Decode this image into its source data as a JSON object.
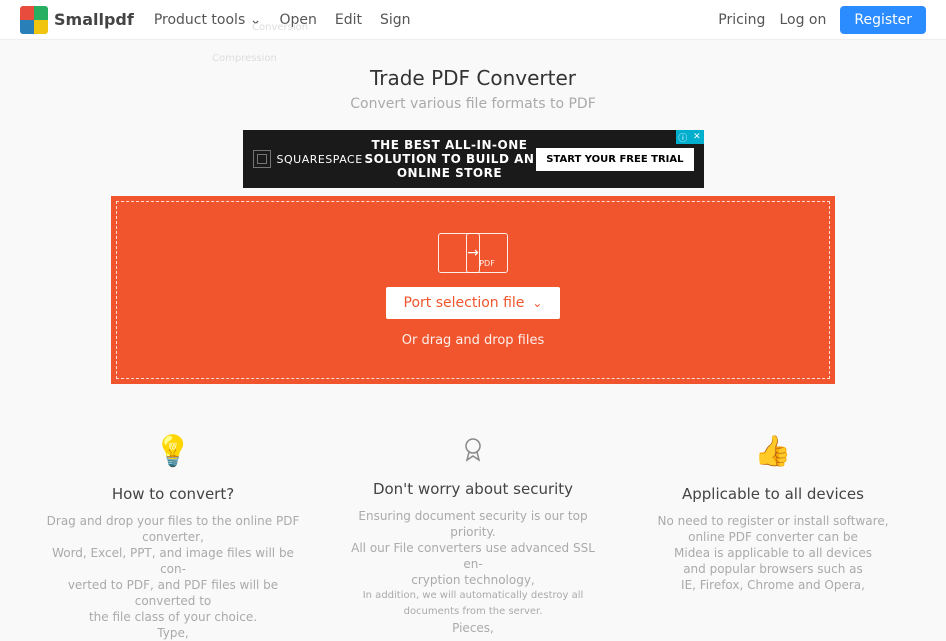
{
  "brand": {
    "name": "Smallpdf"
  },
  "nav": {
    "tools": "Product tools",
    "conversion": "Conversion",
    "compression": "Compression",
    "open": "Open",
    "edit": "Edit",
    "sign": "Sign"
  },
  "nav_right": {
    "pricing": "Pricing",
    "logon": "Log on",
    "register": "Register"
  },
  "hero": {
    "title": "Trade PDF Converter",
    "subtitle": "Convert various file formats to PDF"
  },
  "ad": {
    "brand": "SQUARESPACE",
    "headline": "THE BEST ALL-IN-ONE SOLUTION TO BUILD AN ONLINE STORE",
    "cta": "START YOUR FREE TRIAL"
  },
  "dropzone": {
    "select_label": "Port selection file",
    "drag_label": "Or drag and drop files"
  },
  "features": {
    "f1": {
      "title": "How to convert?",
      "l1": "Drag and drop your files to the online PDF converter,",
      "l2": "Word, Excel, PPT, and image files will be con-",
      "l3": "verted to PDF, and PDF files will be converted to",
      "l4": "the file class of your choice.",
      "l5": "Type,"
    },
    "f2": {
      "title": "Don't worry about security",
      "l1": "Ensuring document security is our top priority.",
      "l2": "All our File converters use advanced SSL en-",
      "l3": "cryption technology,",
      "l4": "In addition, we will automatically destroy all documents from the server.",
      "l5": "Pieces,"
    },
    "f3": {
      "title": "Applicable to all devices",
      "l1": "No need to register or install software, online PDF converter can be",
      "l2": "Midea is applicable to all devices",
      "l3": "and popular browsers such as",
      "l4": "IE, Firefox, Chrome and Opera,"
    }
  }
}
